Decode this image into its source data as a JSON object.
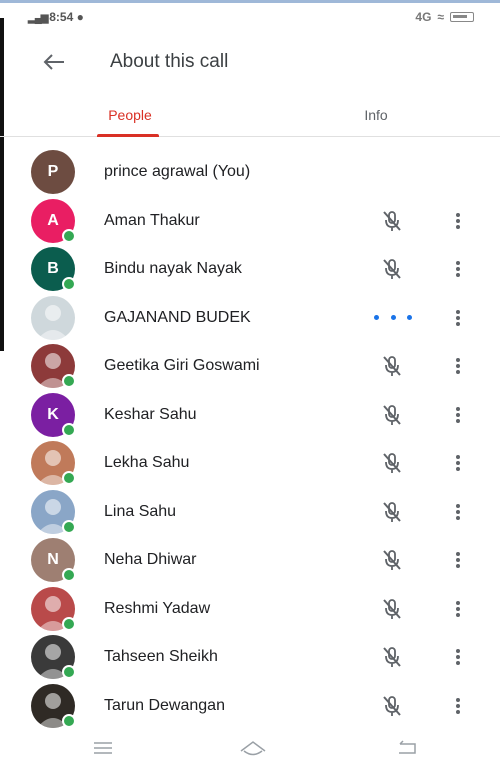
{
  "status_bar": {
    "time": "8:54",
    "signal": "4G",
    "network_right": "4G"
  },
  "app_bar": {
    "title": "About this call"
  },
  "tabs": [
    {
      "label": "People"
    },
    {
      "label": "Info"
    }
  ],
  "participants": [
    {
      "name": "prince agrawal (You)",
      "initial": "P",
      "color": "#6d4c41",
      "presence": false,
      "mic": false,
      "more": false,
      "status": ""
    },
    {
      "name": "Aman Thakur",
      "initial": "A",
      "color": "#e91e63",
      "presence": true,
      "mic": true,
      "more": true,
      "status": "muted"
    },
    {
      "name": "Bindu nayak Nayak",
      "initial": "B",
      "color": "#0b5d4e",
      "presence": true,
      "mic": true,
      "more": true,
      "status": "muted"
    },
    {
      "name": "GAJANAND BUDEK",
      "initial": "",
      "color": "#cfd8dc",
      "presence": false,
      "mic": false,
      "more": true,
      "status": "speaking"
    },
    {
      "name": "Geetika Giri Goswami",
      "initial": "",
      "color": "#8d3a3a",
      "presence": true,
      "mic": true,
      "more": true,
      "status": "muted"
    },
    {
      "name": "Keshar Sahu",
      "initial": "K",
      "color": "#7b1fa2",
      "presence": true,
      "mic": true,
      "more": true,
      "status": "muted"
    },
    {
      "name": "Lekha Sahu",
      "initial": "",
      "color": "#c07a5a",
      "presence": true,
      "mic": true,
      "more": true,
      "status": "muted"
    },
    {
      "name": "Lina Sahu",
      "initial": "",
      "color": "#8aa6c7",
      "presence": true,
      "mic": true,
      "more": true,
      "status": "muted"
    },
    {
      "name": "Neha Dhiwar",
      "initial": "N",
      "color": "#9e7f72",
      "presence": true,
      "mic": true,
      "more": true,
      "status": "muted"
    },
    {
      "name": "Reshmi Yadaw",
      "initial": "",
      "color": "#b94a4a",
      "presence": true,
      "mic": true,
      "more": true,
      "status": "muted"
    },
    {
      "name": "Tahseen Sheikh",
      "initial": "",
      "color": "#3a3a3a",
      "presence": true,
      "mic": true,
      "more": true,
      "status": "muted"
    },
    {
      "name": "Tarun Dewangan",
      "initial": "",
      "color": "#2f2a25",
      "presence": true,
      "mic": true,
      "more": true,
      "status": "muted"
    }
  ],
  "colors": {
    "accent": "#d93025",
    "presence": "#34a853",
    "speaking": "#1a73e8"
  },
  "icons": {
    "back": "arrow-back-icon",
    "mic_off": "mic-off-icon",
    "more": "more-vert-icon",
    "nav": [
      "menu-icon",
      "home-icon",
      "back-icon"
    ]
  }
}
